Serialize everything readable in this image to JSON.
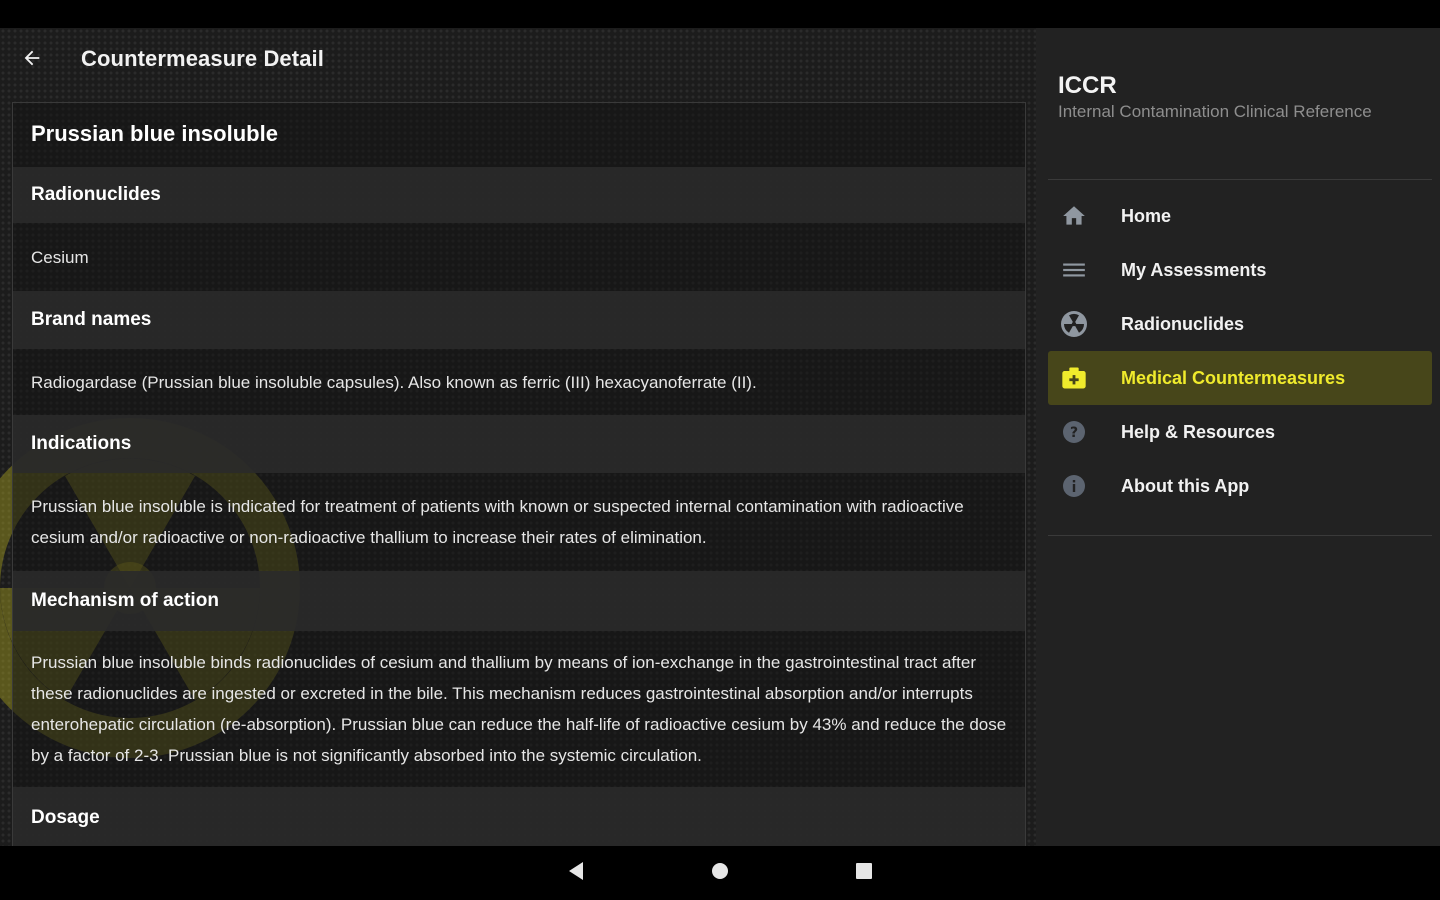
{
  "app_bar": {
    "title": "Countermeasure Detail",
    "back_icon": "arrow-back-icon"
  },
  "detail": {
    "title": "Prussian blue insoluble",
    "sections": [
      {
        "heading": "Radionuclides",
        "body": "Cesium"
      },
      {
        "heading": "Brand names",
        "body": "Radiogardase (Prussian blue insoluble capsules). Also known as ferric (III) hexacyanoferrate (II)."
      },
      {
        "heading": "Indications",
        "body": "Prussian blue insoluble is indicated for treatment of patients with known or suspected internal contamination with radioactive cesium and/or radioactive or non-radioactive thallium to increase their rates of elimination."
      },
      {
        "heading": "Mechanism of action",
        "body": "Prussian blue insoluble binds radionuclides of cesium and thallium by means of ion-exchange in the gastrointestinal tract after these radionuclides are ingested or excreted in the bile. This mechanism reduces gastrointestinal absorption and/or interrupts enterohepatic circulation (re-absorption). Prussian blue can reduce the half-life of radioactive cesium by 43% and reduce the dose by a factor of 2-3. Prussian blue is not significantly absorbed into the systemic circulation."
      },
      {
        "heading": "Dosage"
      }
    ]
  },
  "drawer": {
    "title": "ICCR",
    "subtitle": "Internal Contamination Clinical Reference",
    "items": [
      {
        "label": "Home",
        "icon": "home-icon"
      },
      {
        "label": "My Assessments",
        "icon": "list-icon"
      },
      {
        "label": "Radionuclides",
        "icon": "radiation-icon"
      },
      {
        "label": "Medical Countermeasures",
        "icon": "medical-kit-icon",
        "active": true
      },
      {
        "label": "Help & Resources",
        "icon": "help-icon"
      },
      {
        "label": "About this App",
        "icon": "info-icon"
      }
    ]
  },
  "nav_bar": {
    "back_icon": "nav-back-icon",
    "home_icon": "nav-home-icon",
    "recents_icon": "nav-recents-icon"
  },
  "colors": {
    "accent": "#f0eb2c",
    "active_bg": "#47461a",
    "panel_bg": "#222222",
    "section_header_bg": "#2a2a2a"
  }
}
